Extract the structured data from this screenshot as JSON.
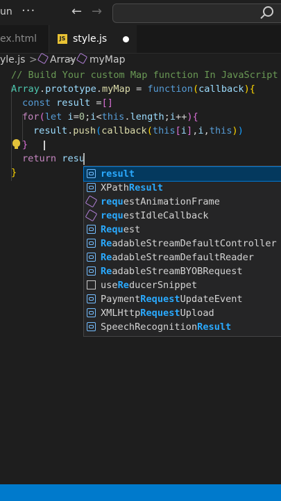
{
  "titlebar": {
    "menu_partial": "un",
    "more_label": "···",
    "back_label": "←",
    "forward_label": "→",
    "search_placeholder": ""
  },
  "tabs": [
    {
      "label": "ex.html",
      "active": false
    },
    {
      "label": "style.js",
      "active": true,
      "icon": "js-icon",
      "unsaved": true
    }
  ],
  "breadcrumb": {
    "file": "yle.js",
    "separator": ">",
    "item1": "Array",
    "item2": "myMap"
  },
  "code": {
    "line1": "// Build Your custom Map function In JavaScript",
    "l2_obj": "Array",
    "l2_proto": "prototype",
    "l2_method": "myMap",
    "l2_func": "function",
    "l2_param": "callback",
    "l3_const": "const",
    "l3_name": "result",
    "l3_op": " =",
    "l3_val": "[]",
    "l4_for": "for",
    "l4_let": "let",
    "l4_i": "i",
    "l4_zero": "0",
    "l4_this": "this",
    "l4_length": "length",
    "l5_result": "result",
    "l5_push": "push",
    "l5_cb": "callback",
    "l5_this1": "this",
    "l5_this2": "this",
    "l6_close": "}",
    "l7_return": "return",
    "l7_typed": "resu",
    "l8_close": "}"
  },
  "suggestions": [
    {
      "pre": "",
      "hl": "result",
      "post": "",
      "icon": "variable-icon",
      "selected": true
    },
    {
      "pre": "XPath",
      "hl": "Result",
      "post": "",
      "icon": "variable-icon"
    },
    {
      "pre": "",
      "hl": "requ",
      "post": "estAnimationFrame",
      "icon": "method-icon"
    },
    {
      "pre": "",
      "hl": "requ",
      "post": "estIdleCallback",
      "icon": "method-icon"
    },
    {
      "pre": "",
      "hl": "Requ",
      "post": "est",
      "icon": "variable-icon"
    },
    {
      "pre": "",
      "hl": "Re",
      "post": "adableStreamDefaultController",
      "icon": "variable-icon"
    },
    {
      "pre": "",
      "hl": "Re",
      "post": "adableStreamDefaultReader",
      "icon": "variable-icon"
    },
    {
      "pre": "",
      "hl": "Re",
      "post": "adableStreamBYOBRequest",
      "icon": "variable-icon"
    },
    {
      "pre": "use",
      "hl": "Re",
      "post": "ducerSnippet",
      "icon": "snippet-icon"
    },
    {
      "pre": "Payment",
      "hl": "Request",
      "post": "UpdateEvent",
      "icon": "variable-icon"
    },
    {
      "pre": "XMLHttp",
      "hl": "Request",
      "post": "Upload",
      "icon": "variable-icon"
    },
    {
      "pre": "SpeechRecognition",
      "hl": "Result",
      "post": "",
      "icon": "variable-icon"
    }
  ],
  "colors": {
    "status_bar": "#007acc",
    "selection": "#04395e",
    "match_highlight": "#2aaaff"
  }
}
